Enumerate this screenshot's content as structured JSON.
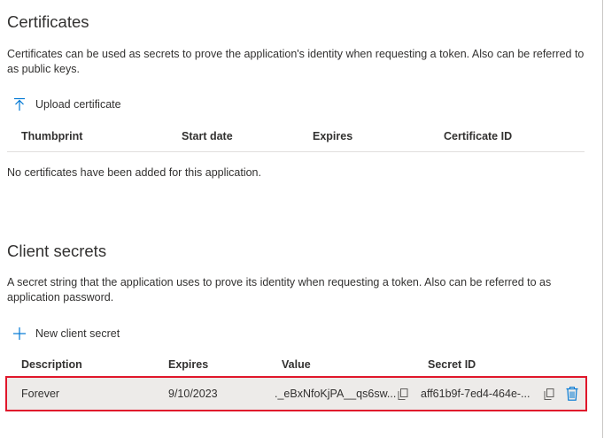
{
  "certificates": {
    "title": "Certificates",
    "description": "Certificates can be used as secrets to prove the application's identity when requesting a token. Also can be referred to as public keys.",
    "upload_label": "Upload certificate",
    "columns": [
      "Thumbprint",
      "Start date",
      "Expires",
      "Certificate ID"
    ],
    "empty_message": "No certificates have been added for this application."
  },
  "client_secrets": {
    "title": "Client secrets",
    "description": "A secret string that the application uses to prove its identity when requesting a token. Also can be referred to as application password.",
    "new_label": "New client secret",
    "columns": [
      "Description",
      "Expires",
      "Value",
      "Secret ID"
    ],
    "rows": [
      {
        "description": "Forever",
        "expires": "9/10/2023",
        "value": "._eBxNfoKjPA__qs6sw...",
        "secret_id": "aff61b9f-7ed4-464e-..."
      }
    ]
  },
  "colors": {
    "accent": "#0078d4",
    "highlight_border": "#e0172b",
    "row_bg": "#edebe9"
  },
  "icons": {
    "upload": "upload-arrow-icon",
    "add": "plus-icon",
    "copy": "copy-icon",
    "delete": "trash-icon"
  }
}
